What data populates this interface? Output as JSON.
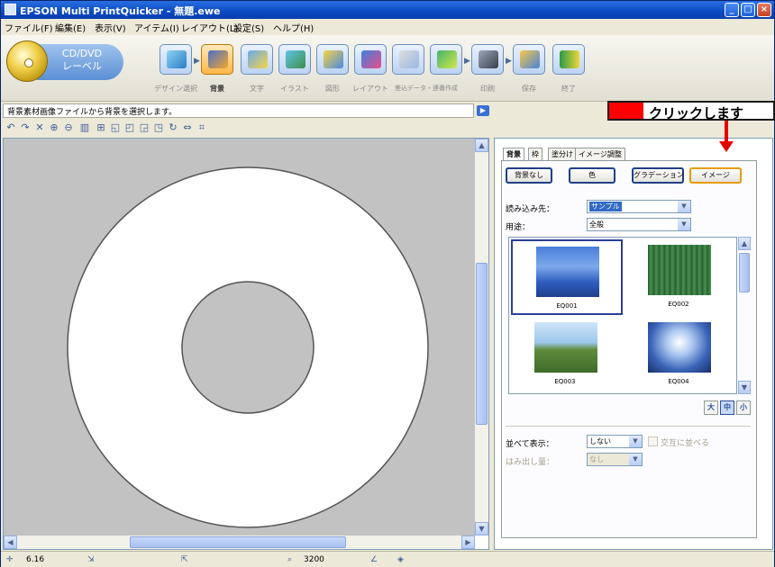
{
  "window": {
    "title": "EPSON Multi PrintQuicker - 無題.ewe"
  },
  "menu": [
    "ファイル(F)",
    "編集(E)",
    "表示(V)",
    "アイテム(I)",
    "レイアウト(L)",
    "設定(S)",
    "ヘルプ(H)"
  ],
  "toolbar": {
    "disc_label": "CD/DVD\nレーベル",
    "tools": [
      "デザイン選択",
      "背景",
      "文字",
      "イラスト",
      "図形",
      "レイアウト",
      "差込データ・連番作成",
      "印刷",
      "保存",
      "終了"
    ]
  },
  "hint_text": "背景素材画像ファイルから背景を選択します。",
  "panel": {
    "tabs": [
      "背景",
      "枠",
      "塗分け",
      "イメージ調整"
    ],
    "buttons": {
      "none": "背景なし",
      "color": "色",
      "gradation": "グラデーション",
      "image": "イメージ"
    },
    "source_label": "読み込み先：",
    "source_value": "サンプル",
    "purpose_label": "用途：",
    "purpose_value": "全般",
    "thumbnails": [
      "EQ001",
      "EQ002",
      "EQ003",
      "EQ004"
    ],
    "size_buttons": [
      "大",
      "中",
      "小"
    ],
    "arrange_label": "並べて表示：",
    "arrange_value": "しない",
    "arrange_check": "交互に並べる",
    "bleed_label": "はみ出し量：",
    "bleed_value": "なし"
  },
  "status": {
    "coords": "6.16",
    "zoom": "3200"
  },
  "annotation": {
    "click_text": "クリックします"
  },
  "colors": {
    "accent": "#316ac5",
    "callout_red": "#ff0000",
    "arrow_red": "#e60000"
  }
}
